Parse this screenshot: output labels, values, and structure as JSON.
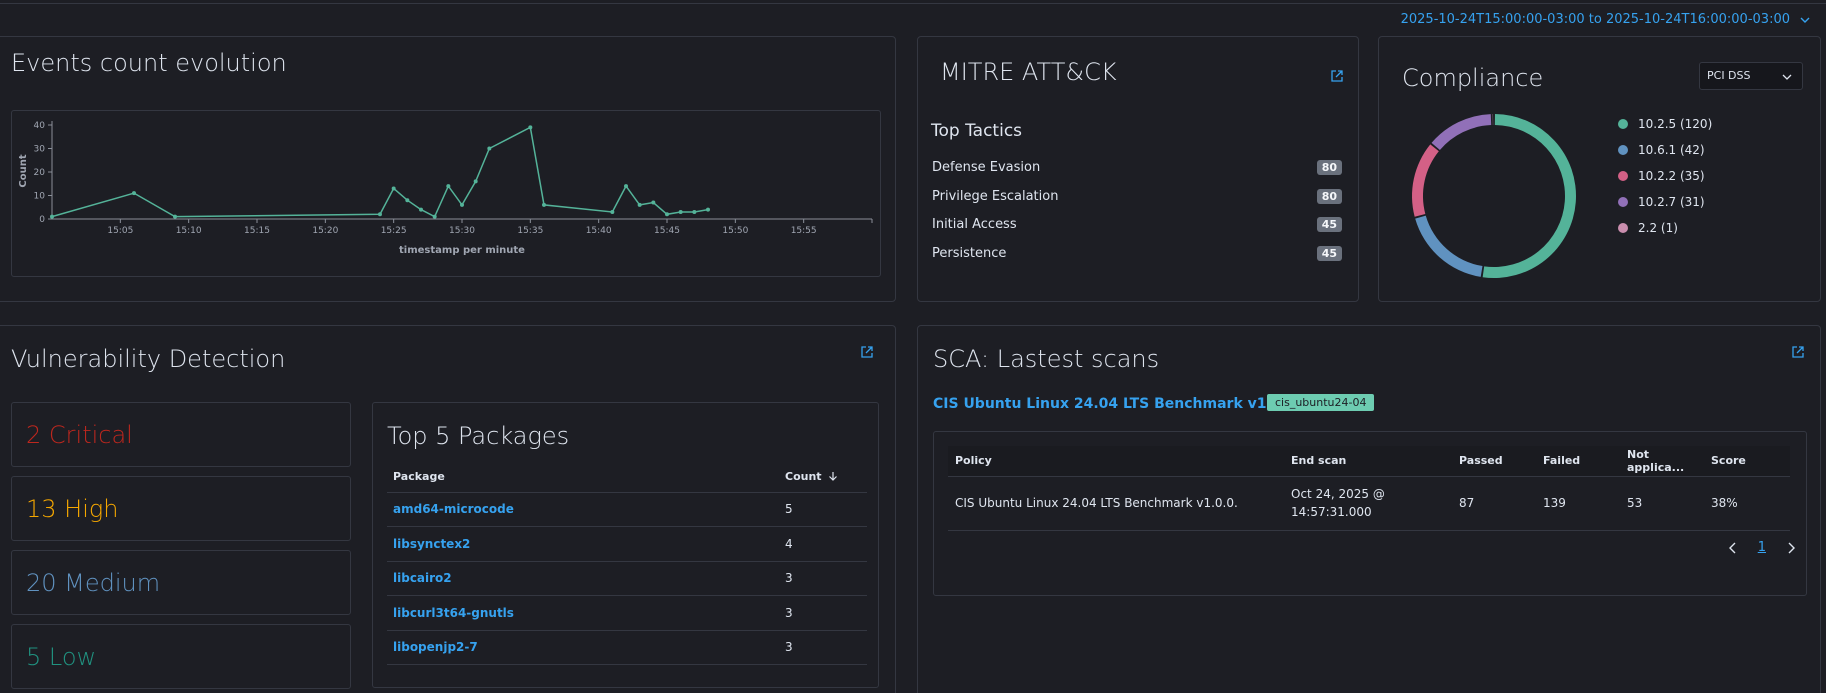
{
  "daterange": "2025-10-24T15:00:00-03:00 to 2025-10-24T16:00:00-03:00",
  "colors": {
    "accent": "#36a2ef",
    "line": "#54b399"
  },
  "events": {
    "title": "Events count evolution",
    "chart_data": {
      "type": "line",
      "xlabel": "timestamp per minute",
      "ylabel": "Count",
      "ylim": [
        0,
        40
      ],
      "yticks": [
        "0",
        "10",
        "20",
        "30",
        "40"
      ],
      "xticks": [
        "15:05",
        "15:10",
        "15:15",
        "15:20",
        "15:25",
        "15:30",
        "15:35",
        "15:40",
        "15:45",
        "15:50",
        "15:55"
      ],
      "x": [
        "15:00",
        "15:06",
        "15:09",
        "15:24",
        "15:25",
        "15:26",
        "15:27",
        "15:28",
        "15:29",
        "15:30",
        "15:31",
        "15:32",
        "15:35",
        "15:36",
        "15:41",
        "15:42",
        "15:43",
        "15:44",
        "15:45",
        "15:46",
        "15:47",
        "15:48"
      ],
      "values": [
        1,
        11,
        1,
        2,
        13,
        8,
        4,
        1,
        14,
        6,
        16,
        30,
        39,
        6,
        3,
        14,
        6,
        7,
        2,
        3,
        3,
        4
      ]
    }
  },
  "mitre": {
    "title": "MITRE ATT&CK",
    "tactics_title": "Top Tactics",
    "tactics": [
      {
        "label": "Defense Evasion",
        "count": "80"
      },
      {
        "label": "Privilege Escalation",
        "count": "80"
      },
      {
        "label": "Initial Access",
        "count": "45"
      },
      {
        "label": "Persistence",
        "count": "45"
      }
    ]
  },
  "compliance": {
    "title": "Compliance",
    "select_value": "PCI DSS",
    "chart_data": {
      "type": "pie",
      "donut": true,
      "categories": [
        "10.2.5 (120)",
        "10.6.1 (42)",
        "10.2.2 (35)",
        "10.2.7 (31)",
        "2.2 (1)"
      ],
      "values": [
        120,
        42,
        35,
        31,
        1
      ],
      "colors": [
        "#54b399",
        "#6092c0",
        "#d36086",
        "#9170b8",
        "#ca8eae"
      ]
    }
  },
  "vuln": {
    "title": "Vulnerability Detection",
    "severities": [
      {
        "label": "2 Critical",
        "color": "#bd271e"
      },
      {
        "label": "13 High",
        "color": "#f5a700"
      },
      {
        "label": "20 Medium",
        "color": "#6092c0"
      },
      {
        "label": "5 Low",
        "color": "#209280"
      }
    ],
    "packages_title": "Top 5 Packages",
    "columns": [
      "Package",
      "Count"
    ],
    "packages": [
      {
        "name": "amd64-microcode",
        "count": "5"
      },
      {
        "name": "libsynctex2",
        "count": "4"
      },
      {
        "name": "libcairo2",
        "count": "3"
      },
      {
        "name": "libcurl3t64-gnutls",
        "count": "3"
      },
      {
        "name": "libopenjp2-7",
        "count": "3"
      }
    ]
  },
  "sca": {
    "title": "SCA: Lastest scans",
    "benchmark_link": "CIS Ubuntu Linux 24.04 LTS Benchmark v1.0.0.",
    "tag": "cis_ubuntu24-04",
    "columns": [
      "Policy",
      "End scan",
      "Passed",
      "Failed",
      "Not applica...",
      "Score"
    ],
    "row": {
      "policy": "CIS Ubuntu Linux 24.04 LTS Benchmark v1.0.0.",
      "end_scan": "Oct 24, 2025 @ 14:57:31.000",
      "passed": "87",
      "failed": "139",
      "not_applicable": "53",
      "score": "38%"
    },
    "page": "1"
  }
}
